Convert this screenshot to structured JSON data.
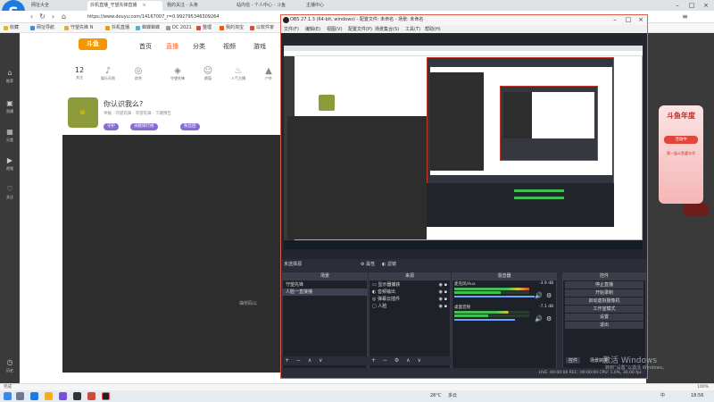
{
  "browser": {
    "tabs": [
      {
        "label": "网址大全"
      },
      {
        "label": "抖机直播_守望先锋直播"
      },
      {
        "label": "我的关注 - 头条"
      },
      {
        "label": "站内信 - 个人中心 - 斗鱼"
      },
      {
        "label": "主播中心"
      }
    ],
    "url": "https://www.douyu.com/14167007_r=0.992795346309264",
    "bookmarks": [
      {
        "label": "收藏"
      },
      {
        "label": "网址导航"
      },
      {
        "label": "守望先锋 N"
      },
      {
        "label": "抖机直播"
      },
      {
        "label": "蝉蝶蝉蝶"
      },
      {
        "label": "DC 2021"
      },
      {
        "label": "整理"
      },
      {
        "label": "我的淘宝"
      },
      {
        "label": "以软件家"
      }
    ],
    "status_text": "完成",
    "zoom": "100%"
  },
  "douyu": {
    "logo": "斗鱼",
    "nav": [
      "首页",
      "直播",
      "分类",
      "视频",
      "游戏"
    ],
    "active_nav": "直播",
    "categories": [
      {
        "num": "12",
        "label": "关注"
      },
      {
        "label": "娱乐天地"
      },
      {
        "label": "综合"
      },
      {
        "label": "守望先锋"
      },
      {
        "label": "颜值"
      },
      {
        "label": "人气主播"
      },
      {
        "label": "户外"
      }
    ],
    "room_title": "你认识我么?",
    "room_sub": "举报 · 守望先锋 · 守望先锋 · 下期预告",
    "pills": [
      "守护",
      "贡献排行榜",
      "粉丝团"
    ],
    "player_text": "抽奖码以",
    "rail": [
      "推荐",
      "直播",
      "分类",
      "视频",
      "关注",
      "历史"
    ],
    "promo_title": "斗鱼年度",
    "promo_btn": "活动中",
    "promo_text": "第一届斗鱼嘉年华"
  },
  "obs": {
    "title": "OBS 27.1.3 (64-bit, windows) - 配置文件: 未命名 - 场景: 未命名",
    "menu": [
      "文件(F)",
      "编辑(E)",
      "视图(V)",
      "配置文件(P)",
      "场景集合(S)",
      "工具(T)",
      "帮助(H)"
    ],
    "source_bar": "未选择源",
    "source_bar_btn1": "属性",
    "source_bar_btn2": "滤镜",
    "scenes_header": "场景",
    "scenes": [
      "守望先锋",
      "人脸一直接播"
    ],
    "sources_header": "来源",
    "sources": [
      "显示器捕获",
      "音频输出",
      "弹幕云插件",
      "人脸"
    ],
    "mixer_header": "混音器",
    "mixer": [
      {
        "label": "麦克风/Aux",
        "db": "-3.9 dB"
      },
      {
        "label": "桌面音频",
        "db": "-7.1 dB"
      }
    ],
    "transitions_header": "场景过渡",
    "controls_header": "控件",
    "controls": [
      "停止直播",
      "开始录制",
      "启动虚拟摄像机",
      "工作室模式",
      "设置",
      "退出"
    ],
    "status": "LIVE: 00:00:00   REC: 00:00:00   CPU: 1.0%, 30.00 fps",
    "bottom_tabs": [
      "控件",
      "场景转换"
    ],
    "nested_title": "斗鱼",
    "tab_ctl": [
      "属性",
      "滤镜"
    ]
  },
  "windows": {
    "activate_title": "激活 Windows",
    "activate_sub": "转到“设置”以激活 Windows。",
    "temp": "28°C",
    "weather": "多云",
    "time": "18:56",
    "ime": "中"
  }
}
